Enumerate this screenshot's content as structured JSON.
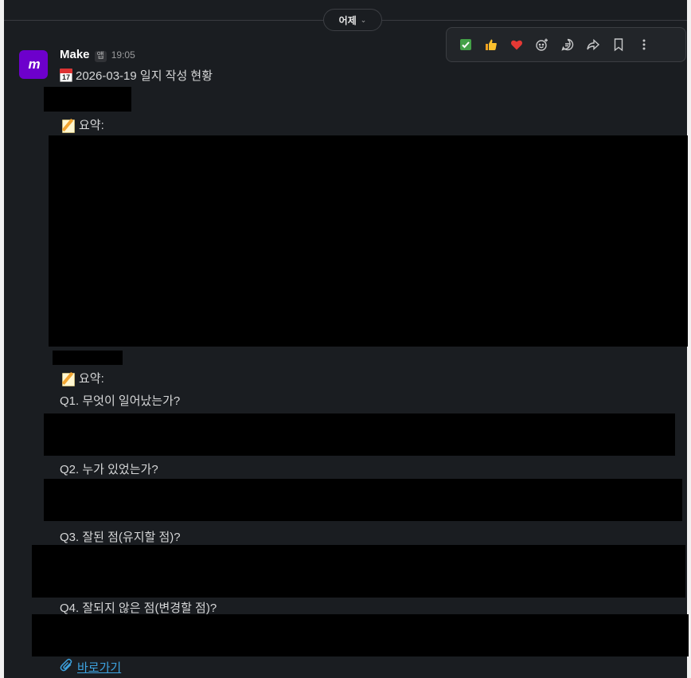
{
  "day_divider": {
    "label": "어제"
  },
  "hover_toolbar": {
    "items": [
      "check-mark-emoji",
      "thumbs-up-emoji",
      "heart-emoji",
      "add-reaction-icon",
      "reply-in-thread-icon",
      "forward-icon",
      "bookmark-icon",
      "more-icon"
    ]
  },
  "message": {
    "avatar_text": "m",
    "sender": "Make",
    "app_badge": "앱",
    "time": "19:05",
    "title": "2026-03-19 일지 작성 현황",
    "calendar_emoji_day": "17",
    "summary_label_1": "요약:",
    "summary_label_2": "요약:",
    "q1": "Q1. 무엇이 일어났는가?",
    "q2": "Q2. 누가 있었는가?",
    "q3": "Q3. 잘된 점(유지할 점)?",
    "q4": "Q4. 잘되지 않은 점(변경할 점)?",
    "link_text": "바로가기"
  },
  "colors": {
    "background": "#1a1d21",
    "avatar": "#6d00cc",
    "link": "#3da3e0"
  }
}
